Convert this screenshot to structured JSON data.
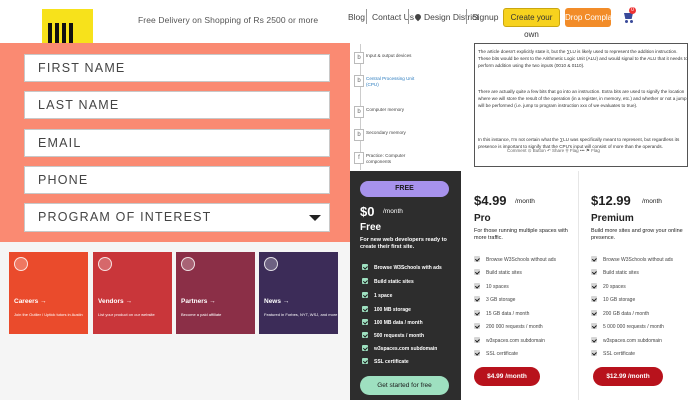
{
  "header": {
    "delivery_text": "Free Delivery on Shopping of Rs 2500 or more",
    "links": [
      "Blog",
      "Contact Us",
      "Design District",
      "Signup"
    ],
    "create_label": "Create your own",
    "drop_label": "Drop Complaint",
    "cart_count": "0",
    "logo_icon": "logo-bars-icon"
  },
  "form": {
    "first_name": "FIRST NAME",
    "last_name": "LAST NAME",
    "email": "EMAIL",
    "phone": "PHONE",
    "program": "PROGRAM OF INTEREST",
    "panel_color": "#fa8a72"
  },
  "cards": [
    {
      "title": "Careers →",
      "desc": "Join the Outlier / Uptick tutors in Austin",
      "color": "#ea4b2c"
    },
    {
      "title": "Vendors →",
      "desc": "List your product on our website",
      "color": "#c9363a"
    },
    {
      "title": "Partners →",
      "desc": "Become a paid affiliate",
      "color": "#8b2f47"
    },
    {
      "title": "News →",
      "desc": "Featured in Forbes, NYT, WSJ, and more",
      "color": "#3c2c58"
    }
  ],
  "lessons": [
    {
      "mark": "b",
      "label": "Input & output devices"
    },
    {
      "mark": "b",
      "label": "Central Processing Unit (CPU)"
    },
    {
      "mark": "b",
      "label": "Computer memory"
    },
    {
      "mark": "b",
      "label": "Secondary memory"
    },
    {
      "mark": "f",
      "label": "Practice: Computer components"
    }
  ],
  "article": {
    "p1": "The article doesn't explicitly state it, but the ∑LU is likely used to represent the addition instruction. These bits would be sent to the Arithmetic Logic Unit (ALU) and would signal to the ALU that it needs to perform addition using the two inputs (0010 & 0110).",
    "p2": "There are actually quite a few bits that go into an instruction. Extra bits are used to signify the location where we will store the result of the operation (in a register, in memory, etc.) and whether or not a jump will be performed (i.e. jump to program instruction xxx of we evaluates to true).",
    "p3": "In this instance, I'm not certain what the ∑LU was specifically meant to represent, but regardless its presence is important to signify that the CPU's input will consist of more than the operands.",
    "comment_bar": "Comment    ⊙ Button    ↶ Share    ⚲ Flag    •••    ⚑ Flag"
  },
  "pricing": {
    "free": {
      "badge": "FREE",
      "price": "$0",
      "per": "/month",
      "name": "Free",
      "desc": "For new web developers ready to create their first site.",
      "features": [
        "Browse W3Schools with ads",
        "Build static sites",
        "1 space",
        "100 MB storage",
        "100 MB data / month",
        "500 requests / month",
        "w3spaces.com subdomain",
        "SSL certificate"
      ],
      "cta": "Get started for free",
      "accent": "#a792ec",
      "cta_color": "#9ee0c0"
    },
    "pro": {
      "price": "$4.99",
      "per": "/month",
      "name": "Pro",
      "desc": "For those running multiple spaces with more traffic.",
      "features": [
        "Browse W3Schools without ads",
        "Build static sites",
        "10 spaces",
        "3 GB storage",
        "15 GB data / month",
        "200 000 requests / month",
        "w3spaces.com subdomain",
        "SSL certificate"
      ],
      "cta": "$4.99 /month",
      "cta_color": "#b8121c"
    },
    "premium": {
      "price": "$12.99",
      "per": "/month",
      "name": "Premium",
      "desc": "Build more sites and grow your online presence.",
      "features": [
        "Browse W3Schools without ads",
        "Build static sites",
        "20 spaces",
        "10 GB storage",
        "200 GB data / month",
        "5 000 000 requests / month",
        "w3spaces.com subdomain",
        "SSL certificate"
      ],
      "cta": "$12.99 /month",
      "cta_color": "#b8121c"
    }
  }
}
